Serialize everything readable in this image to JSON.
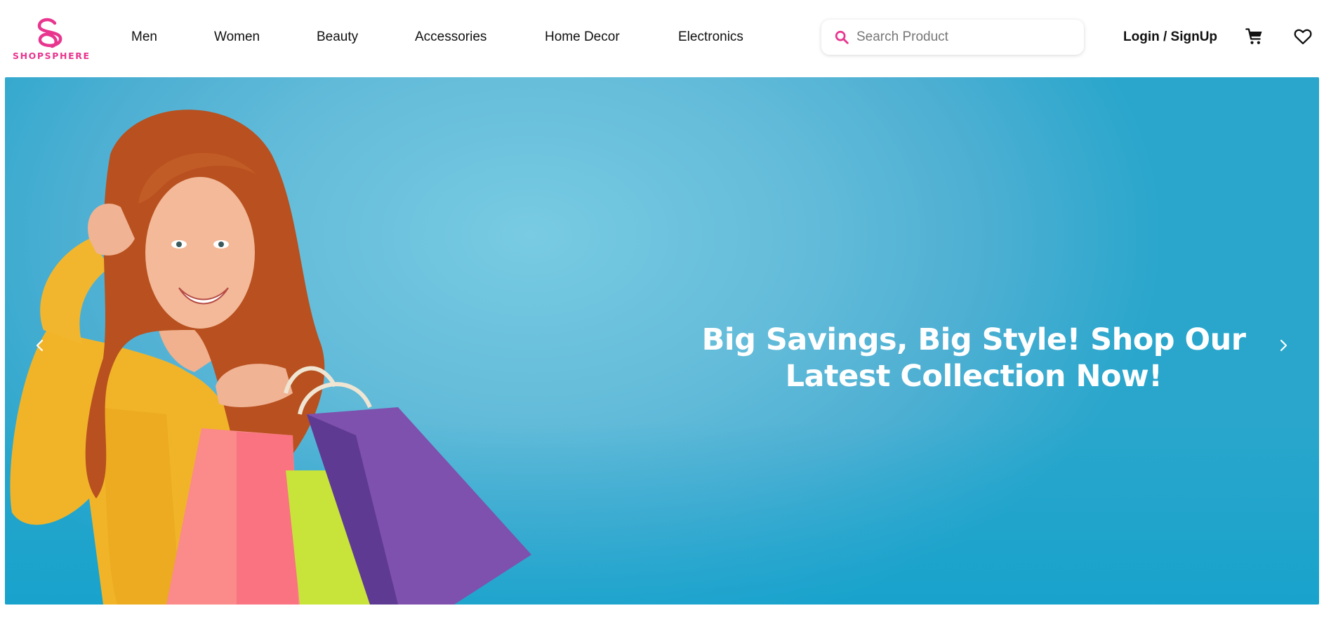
{
  "brand": {
    "name": "SHOPSPHERE",
    "color": "#e8368f"
  },
  "nav": {
    "items": [
      {
        "label": "Men"
      },
      {
        "label": "Women"
      },
      {
        "label": "Beauty"
      },
      {
        "label": "Accessories"
      },
      {
        "label": "Home Decor"
      },
      {
        "label": "Electronics"
      }
    ]
  },
  "search": {
    "placeholder": "Search Product",
    "value": "",
    "icon": "search-icon"
  },
  "header_actions": {
    "login_label": "Login / SignUp",
    "cart_icon": "cart-icon",
    "wishlist_icon": "heart-icon"
  },
  "hero": {
    "headline": "Big Savings, Big Style! Shop Our Latest Collection Now!",
    "prev_icon": "chevron-left-icon",
    "next_icon": "chevron-right-icon",
    "background_color": "#5fbad9"
  }
}
